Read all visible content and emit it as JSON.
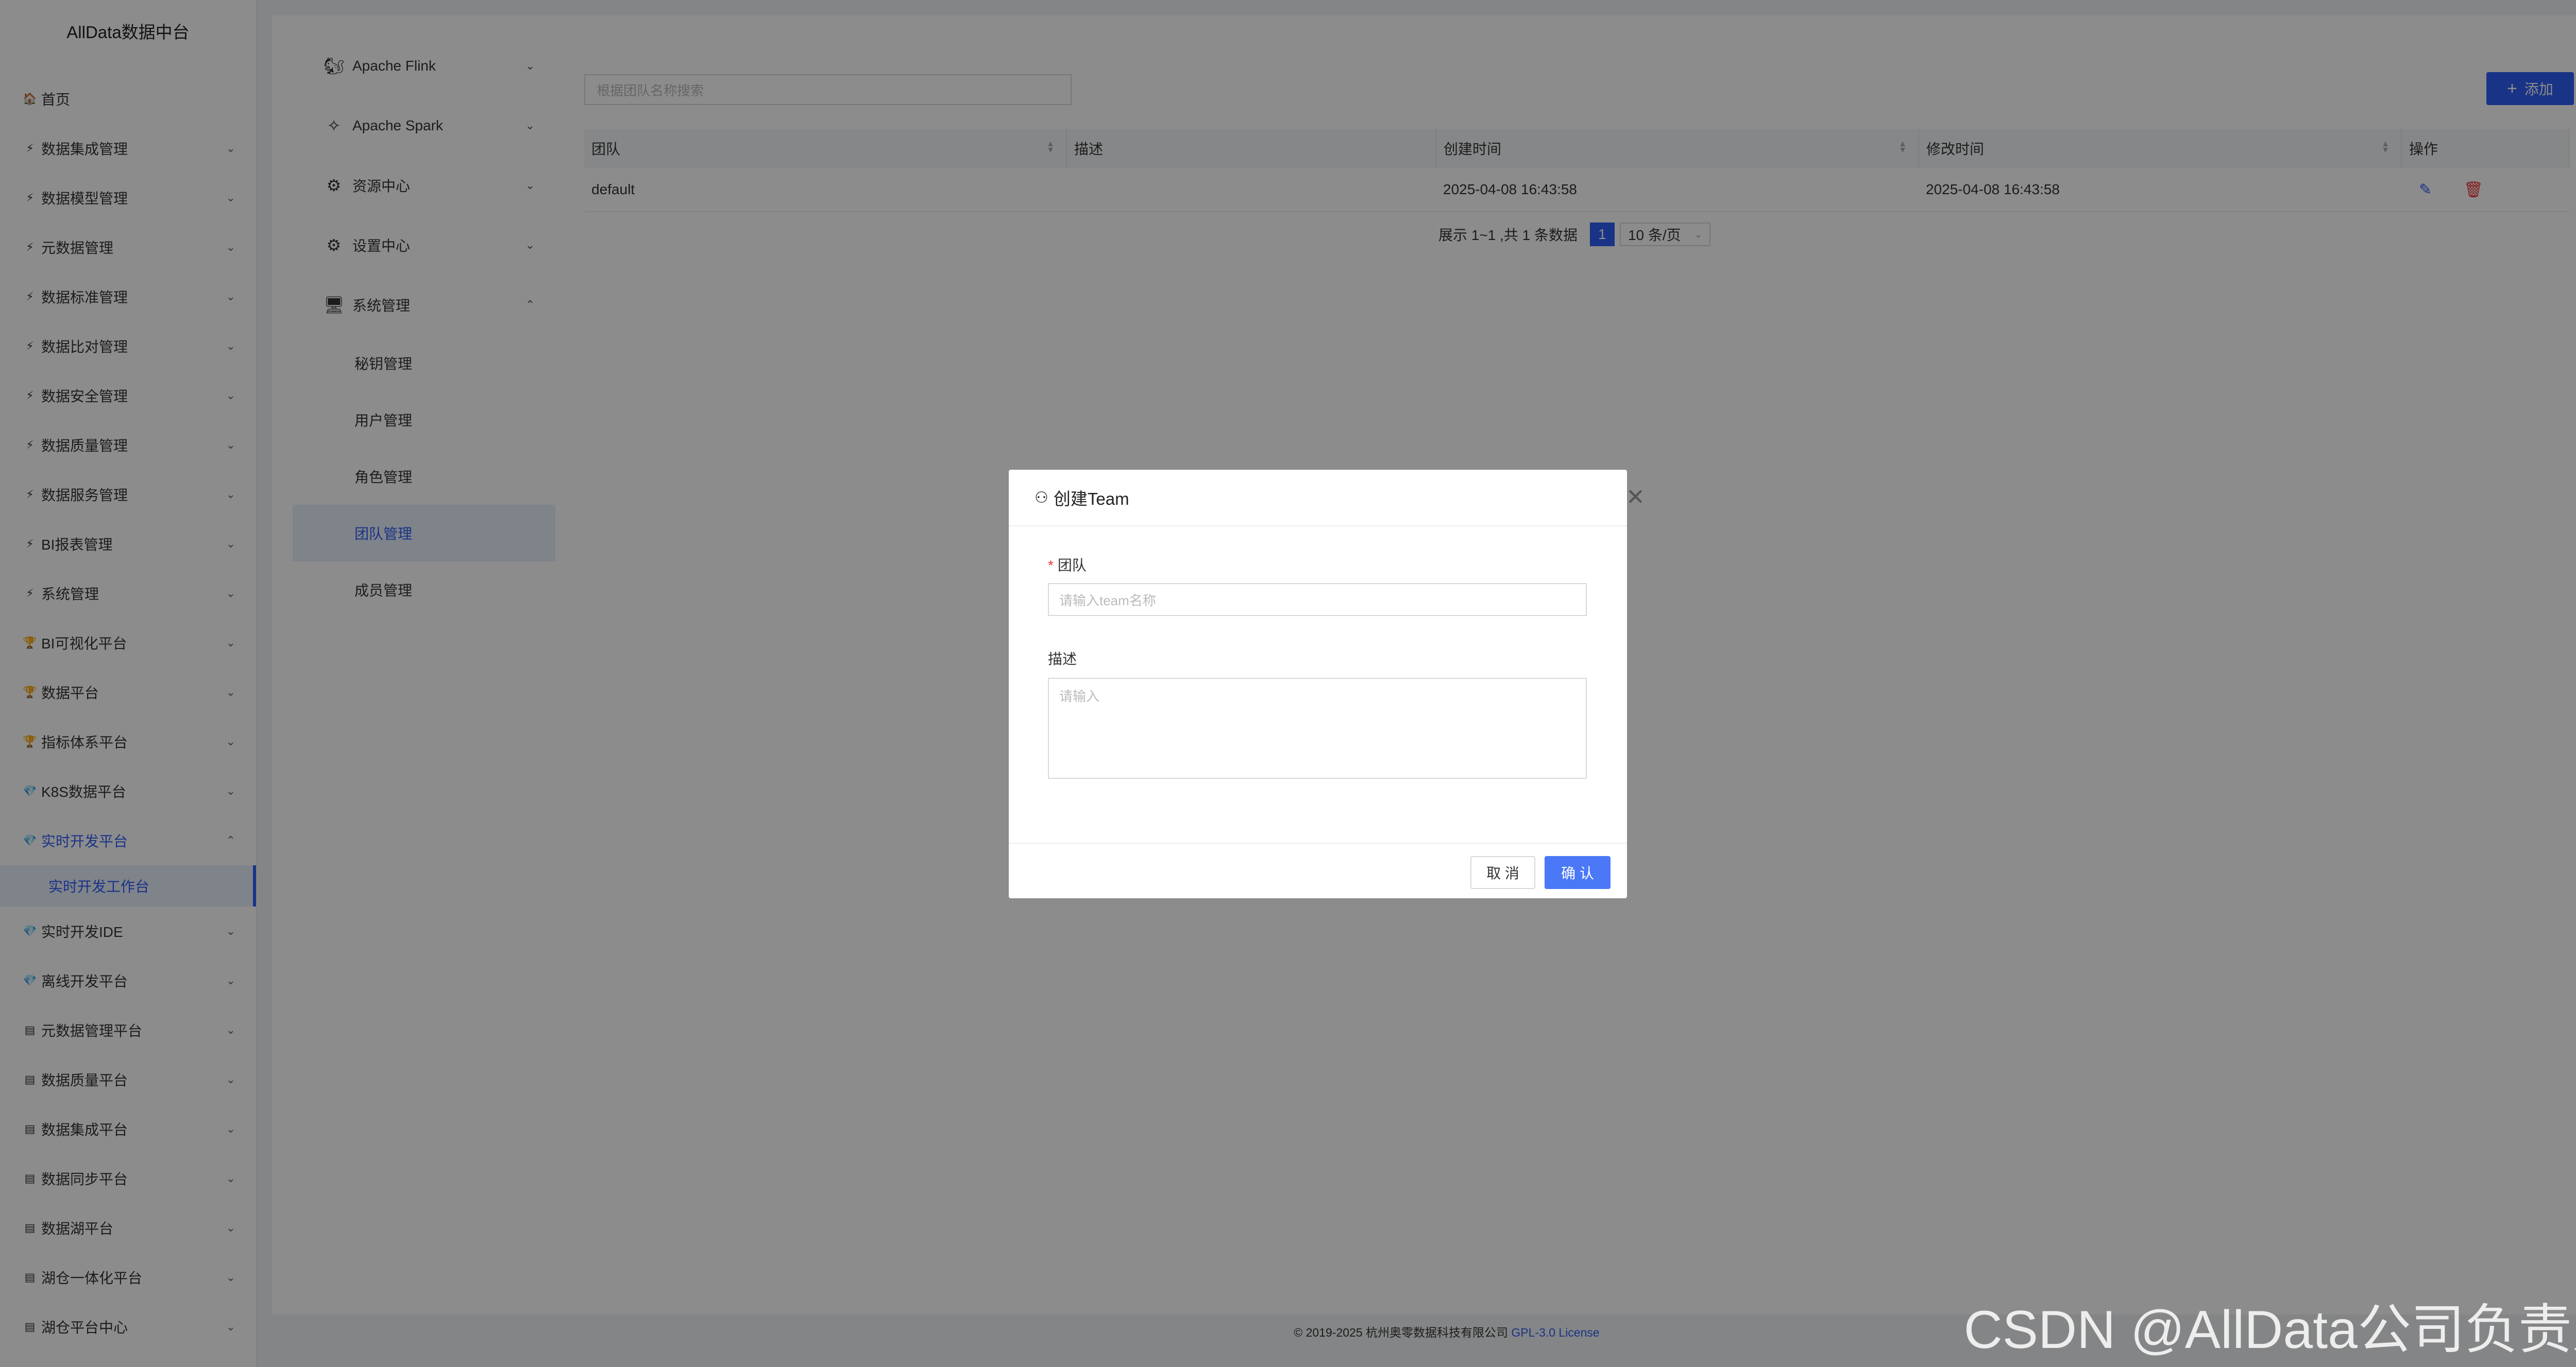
{
  "brand": "AllData数据中台",
  "sidebar": {
    "items": [
      {
        "label": "首页",
        "icon": "home-icon",
        "glyph": "🏠",
        "chevron": false
      },
      {
        "label": "数据集成管理",
        "icon": "bolt-icon",
        "glyph": "⚡",
        "chevron": true
      },
      {
        "label": "数据模型管理",
        "icon": "bolt-icon",
        "glyph": "⚡",
        "chevron": true
      },
      {
        "label": "元数据管理",
        "icon": "bolt-icon",
        "glyph": "⚡",
        "chevron": true
      },
      {
        "label": "数据标准管理",
        "icon": "bolt-icon",
        "glyph": "⚡",
        "chevron": true
      },
      {
        "label": "数据比对管理",
        "icon": "bolt-icon",
        "glyph": "⚡",
        "chevron": true
      },
      {
        "label": "数据安全管理",
        "icon": "bolt-icon",
        "glyph": "⚡",
        "chevron": true
      },
      {
        "label": "数据质量管理",
        "icon": "bolt-icon",
        "glyph": "⚡",
        "chevron": true
      },
      {
        "label": "数据服务管理",
        "icon": "bolt-icon",
        "glyph": "⚡",
        "chevron": true
      },
      {
        "label": "BI报表管理",
        "icon": "bolt-icon",
        "glyph": "⚡",
        "chevron": true
      },
      {
        "label": "系统管理",
        "icon": "bolt-icon",
        "glyph": "⚡",
        "chevron": true
      },
      {
        "label": "BI可视化平台",
        "icon": "trophy-icon",
        "glyph": "🏆",
        "chevron": true
      },
      {
        "label": "数据平台",
        "icon": "trophy-icon",
        "glyph": "🏆",
        "chevron": true
      },
      {
        "label": "指标体系平台",
        "icon": "trophy-icon",
        "glyph": "🏆",
        "chevron": true
      },
      {
        "label": "K8S数据平台",
        "icon": "diamond-icon",
        "glyph": "💎",
        "chevron": true
      },
      {
        "label": "实时开发平台",
        "icon": "diamond-icon",
        "glyph": "💎",
        "chevron": true,
        "expanded": true
      },
      {
        "label": "实时开发IDE",
        "icon": "diamond-icon",
        "glyph": "💎",
        "chevron": true
      },
      {
        "label": "离线开发平台",
        "icon": "diamond-icon",
        "glyph": "💎",
        "chevron": true
      },
      {
        "label": "元数据管理平台",
        "icon": "grid-icon",
        "glyph": "▤",
        "chevron": true
      },
      {
        "label": "数据质量平台",
        "icon": "grid-icon",
        "glyph": "▤",
        "chevron": true
      },
      {
        "label": "数据集成平台",
        "icon": "grid-icon",
        "glyph": "▤",
        "chevron": true
      },
      {
        "label": "数据同步平台",
        "icon": "grid-icon",
        "glyph": "▤",
        "chevron": true
      },
      {
        "label": "数据湖平台",
        "icon": "grid-icon",
        "glyph": "▤",
        "chevron": true
      },
      {
        "label": "湖仓一体化平台",
        "icon": "grid-icon",
        "glyph": "▤",
        "chevron": true
      },
      {
        "label": "湖仓平台中心",
        "icon": "grid-icon",
        "glyph": "▤",
        "chevron": true
      }
    ],
    "active_sub": "实时开发工作台"
  },
  "subnav": {
    "groups": [
      {
        "label": "Apache Flink",
        "icon": "flink-icon",
        "glyph": "🐿",
        "open": false
      },
      {
        "label": "Apache Spark",
        "icon": "spark-icon",
        "glyph": "✧",
        "open": false
      },
      {
        "label": "资源中心",
        "icon": "resource-icon",
        "glyph": "⚙",
        "open": false
      },
      {
        "label": "设置中心",
        "icon": "settings-icon",
        "glyph": "⚙",
        "open": false
      },
      {
        "label": "系统管理",
        "icon": "monitor-icon",
        "glyph": "🖥",
        "open": true
      }
    ],
    "children": [
      "秘钥管理",
      "用户管理",
      "角色管理",
      "团队管理",
      "成员管理"
    ],
    "active_child": "团队管理"
  },
  "toolbar": {
    "search_placeholder": "根据团队名称搜索",
    "add_label": "添加"
  },
  "table": {
    "columns": [
      "团队",
      "描述",
      "创建时间",
      "修改时间",
      "操作"
    ],
    "rows": [
      {
        "team": "default",
        "desc": "",
        "created": "2025-04-08 16:43:58",
        "modified": "2025-04-08 16:43:58"
      }
    ]
  },
  "pager": {
    "summary": "展示 1~1 ,共 1 条数据",
    "current": "1",
    "page_size": "10 条/页"
  },
  "footer": {
    "copyright": "© 2019-2025 杭州奥零数据科技有限公司",
    "license": "GPL-3.0 License"
  },
  "modal": {
    "title": "创建Team",
    "team_label": "团队",
    "team_placeholder": "请输入team名称",
    "desc_label": "描述",
    "desc_placeholder": "请输入",
    "cancel": "取 消",
    "ok": "确 认"
  },
  "watermark": "CSDN @AllData公司负责人"
}
